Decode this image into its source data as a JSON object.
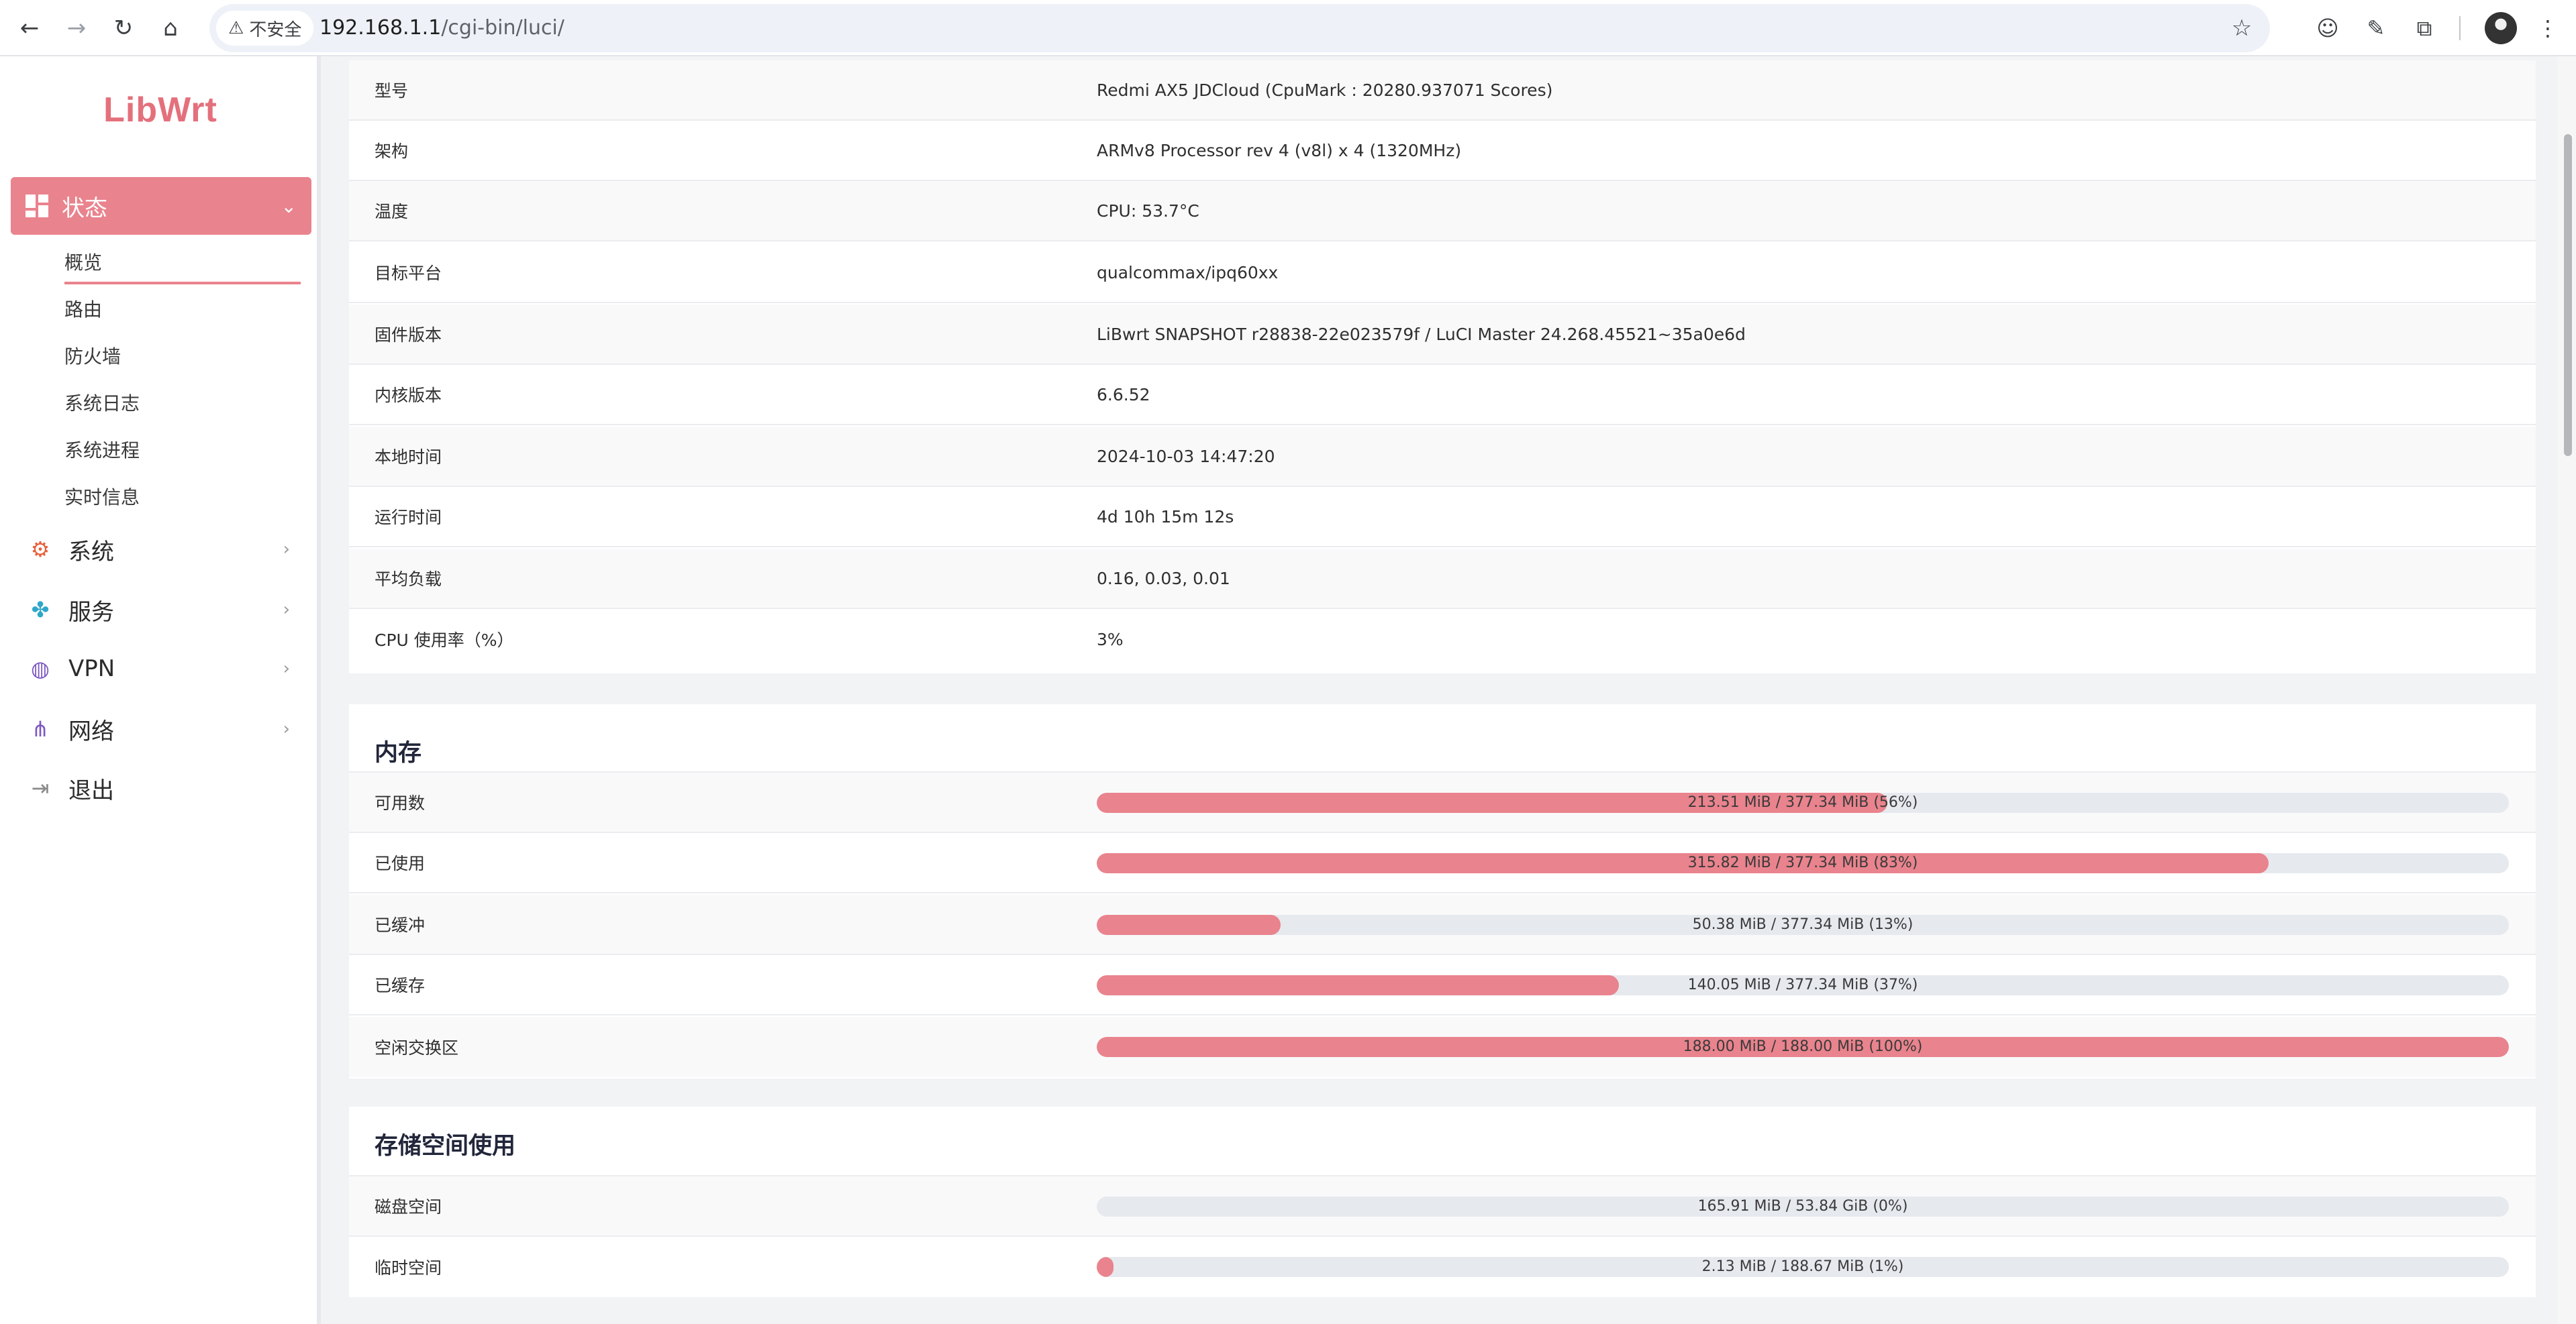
{
  "browser": {
    "security_label": "不安全",
    "url_host": "192.168.1.1",
    "url_path": "/cgi-bin/luci/"
  },
  "sidebar": {
    "logo": "LibWrt",
    "active_menu": {
      "label": "状态",
      "icon": "dashboard-icon"
    },
    "submenu": [
      "概览",
      "路由",
      "防火墙",
      "系统日志",
      "系统进程",
      "实时信息"
    ],
    "items": [
      {
        "label": "系统",
        "icon": "gear-icon",
        "color": "#e8613c"
      },
      {
        "label": "服务",
        "icon": "puzzle-icon",
        "color": "#2fa7c9"
      },
      {
        "label": "VPN",
        "icon": "globe-icon",
        "color": "#7e57c2"
      },
      {
        "label": "网络",
        "icon": "network-icon",
        "color": "#7e57c2"
      },
      {
        "label": "退出",
        "icon": "logout-icon",
        "color": "#8a8a8a"
      }
    ]
  },
  "system": {
    "rows": [
      {
        "key": "型号",
        "value": "Redmi AX5 JDCloud (CpuMark : 20280.937071 Scores)"
      },
      {
        "key": "架构",
        "value": "ARMv8 Processor rev 4 (v8l) x 4 (1320MHz)"
      },
      {
        "key": "温度",
        "value": "CPU: 53.7°C"
      },
      {
        "key": "目标平台",
        "value": "qualcommax/ipq60xx"
      },
      {
        "key": "固件版本",
        "value": "LiBwrt SNAPSHOT r28838-22e023579f / LuCI Master 24.268.45521~35a0e6d"
      },
      {
        "key": "内核版本",
        "value": "6.6.52"
      },
      {
        "key": "本地时间",
        "value": "2024-10-03 14:47:20"
      },
      {
        "key": "运行时间",
        "value": "4d 10h 15m 12s"
      },
      {
        "key": "平均负载",
        "value": "0.16, 0.03, 0.01"
      },
      {
        "key": "CPU 使用率（%）",
        "value": "3%"
      }
    ]
  },
  "memory": {
    "title": "内存",
    "rows": [
      {
        "key": "可用数",
        "text": "213.51 MiB / 377.34 MiB (56%)",
        "fraction": 0.56
      },
      {
        "key": "已使用",
        "text": "315.82 MiB / 377.34 MiB (83%)",
        "fraction": 0.83
      },
      {
        "key": "已缓冲",
        "text": "50.38 MiB / 377.34 MiB (13%)",
        "fraction": 0.13
      },
      {
        "key": "已缓存",
        "text": "140.05 MiB / 377.34 MiB (37%)",
        "fraction": 0.37
      },
      {
        "key": "空闲交换区",
        "text": "188.00 MiB / 188.00 MiB (100%)",
        "fraction": 1.0
      }
    ]
  },
  "storage": {
    "title": "存储空间使用",
    "rows": [
      {
        "key": "磁盘空间",
        "text": "165.91 MiB / 53.84 GiB (0%)",
        "fraction": 0.0
      },
      {
        "key": "临时空间",
        "text": "2.13 MiB / 188.67 MiB (1%)",
        "fraction": 0.01
      }
    ]
  },
  "colors": {
    "accent": "#e9838d",
    "track": "#e6e9ee"
  }
}
